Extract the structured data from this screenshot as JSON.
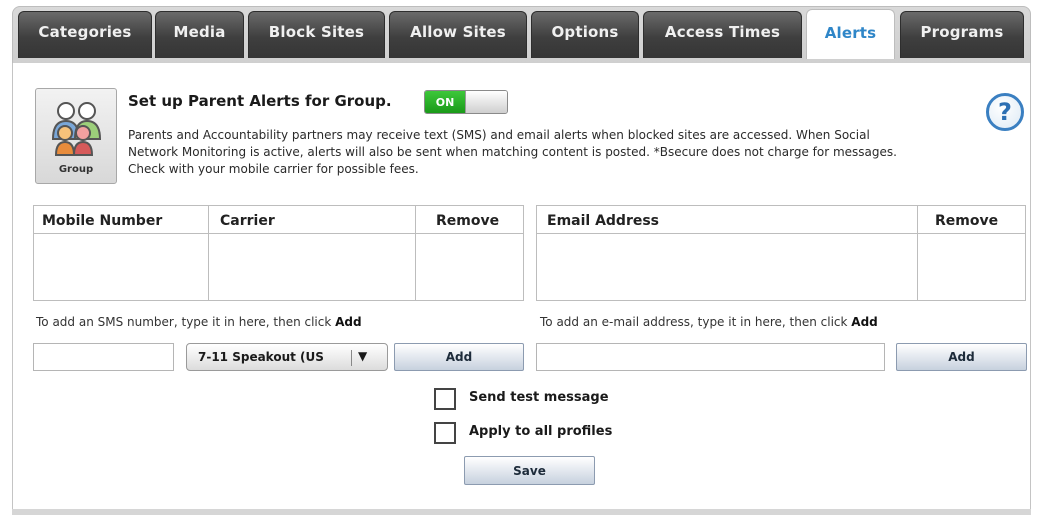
{
  "tabs": [
    {
      "label": "Categories",
      "active": false
    },
    {
      "label": "Media",
      "active": false
    },
    {
      "label": "Block Sites",
      "active": false
    },
    {
      "label": "Allow Sites",
      "active": false
    },
    {
      "label": "Options",
      "active": false
    },
    {
      "label": "Access Times",
      "active": false
    },
    {
      "label": "Alerts",
      "active": true
    },
    {
      "label": "Programs",
      "active": false
    }
  ],
  "group": {
    "label": "Group"
  },
  "alerts": {
    "heading": "Set up Parent Alerts for Group.",
    "toggle_label": "ON",
    "toggle_state": "on",
    "description": "Parents and Accountability partners may receive text (SMS) and email alerts when blocked sites are accessed.  When Social Network Monitoring is active, alerts will also be sent when matching content is posted.  *Bsecure does not charge for messages.  Check with your mobile carrier for possible fees."
  },
  "help": {
    "icon": "help-icon",
    "glyph": "?"
  },
  "sms_table": {
    "headers": [
      "Mobile Number",
      "Carrier",
      "Remove"
    ],
    "rows": []
  },
  "email_table": {
    "headers": [
      "Email Address",
      "Remove"
    ],
    "rows": []
  },
  "sms_form": {
    "hint": "To add an SMS number, type it in here, then click",
    "hint_bold": "Add",
    "number_value": "",
    "carrier_selected": "7-11 Speakout (US",
    "add_label": "Add"
  },
  "email_form": {
    "hint": "To add an e-mail address, type it in here, then click",
    "hint_bold": "Add",
    "email_value": "",
    "add_label": "Add"
  },
  "options": {
    "send_test_label": "Send test message",
    "send_test_checked": false,
    "apply_all_label": "Apply to all profiles",
    "apply_all_checked": false
  },
  "save_label": "Save",
  "colors": {
    "active_tab_text": "#2f86c8",
    "toggle_on": "#1a9a19",
    "tab_dark": "#3f3f3f"
  }
}
